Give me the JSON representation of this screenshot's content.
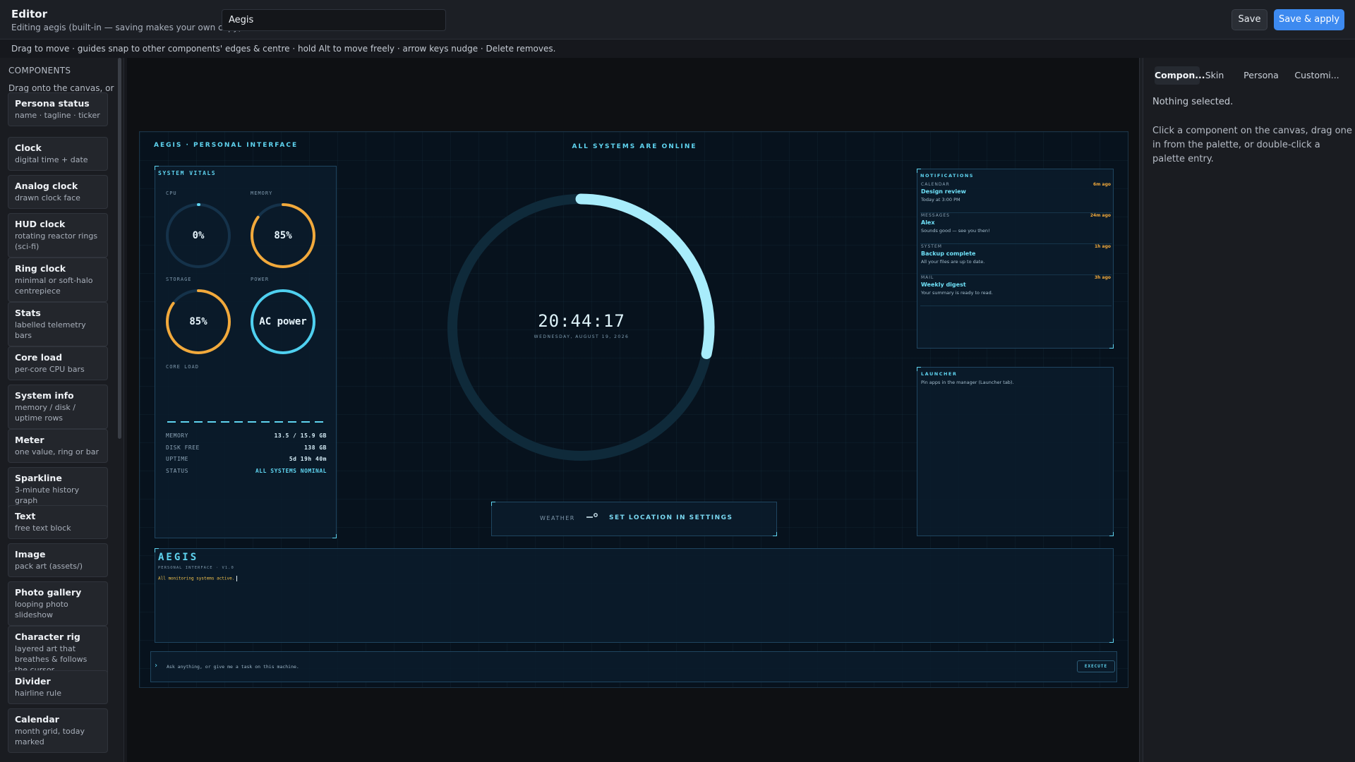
{
  "header": {
    "title": "Editor",
    "subtitle": "Editing aegis (built-in — saving makes your own copy)",
    "name_value": "Aegis",
    "save_label": "Save",
    "save_apply_label": "Save & apply"
  },
  "hint": "Drag to move · guides snap to other components' edges & centre · hold Alt to move freely · arrow keys nudge · Delete removes.",
  "palette": {
    "heading": "COMPONENTS",
    "help": "Drag onto the canvas, or double-click to add.",
    "items": [
      {
        "title": "Persona status",
        "desc": "name · tagline · ticker"
      },
      {
        "title": "Clock",
        "desc": "digital time + date"
      },
      {
        "title": "Analog clock",
        "desc": "drawn clock face"
      },
      {
        "title": "HUD clock",
        "desc": "rotating reactor rings (sci-fi)"
      },
      {
        "title": "Ring clock",
        "desc": "minimal or soft-halo centrepiece"
      },
      {
        "title": "Stats",
        "desc": "labelled telemetry bars"
      },
      {
        "title": "Core load",
        "desc": "per-core CPU bars"
      },
      {
        "title": "System info",
        "desc": "memory / disk / uptime rows"
      },
      {
        "title": "Meter",
        "desc": "one value, ring or bar"
      },
      {
        "title": "Sparkline",
        "desc": "3-minute history graph"
      },
      {
        "title": "Text",
        "desc": "free text block"
      },
      {
        "title": "Image",
        "desc": "pack art (assets/)"
      },
      {
        "title": "Photo gallery",
        "desc": "looping photo slideshow"
      },
      {
        "title": "Character rig",
        "desc": "layered art that breathes & follows the cursor"
      },
      {
        "title": "Divider",
        "desc": "hairline rule"
      },
      {
        "title": "Calendar",
        "desc": "month grid, today marked"
      }
    ]
  },
  "hud": {
    "brand": "AEGIS · PERSONAL INTERFACE",
    "status": "ALL SYSTEMS ARE ONLINE",
    "vitals": {
      "title": "SYSTEM VITALS",
      "cpu_label": "CPU",
      "cpu_value": "0%",
      "cpu_fraction": 0.0,
      "memory_label": "MEMORY",
      "memory_value": "85%",
      "memory_fraction": 0.85,
      "storage_label": "STORAGE",
      "storage_value": "85%",
      "storage_fraction": 0.85,
      "power_label": "POWER",
      "power_value": "AC power",
      "power_fraction": 1.0,
      "core_label": "CORE LOAD",
      "core_count": 12,
      "rows": [
        {
          "k": "MEMORY",
          "v": "13.5 / 15.9 GB"
        },
        {
          "k": "DISK FREE",
          "v": "138 GB"
        },
        {
          "k": "UPTIME",
          "v": "5d 19h 40m"
        },
        {
          "k": "STATUS",
          "v": "ALL SYSTEMS NOMINAL"
        }
      ]
    },
    "clock": {
      "time": "20:44:17",
      "date": "WEDNESDAY, AUGUST 19, 2026",
      "seconds_fraction": 0.283
    },
    "weather": {
      "label": "WEATHER",
      "message": "SET LOCATION IN SETTINGS"
    },
    "notifications": {
      "title": "NOTIFICATIONS",
      "items": [
        {
          "cat": "CALENDAR",
          "age": "6m ago",
          "title": "Design review",
          "msg": "Today at 3:00 PM"
        },
        {
          "cat": "MESSAGES",
          "age": "24m ago",
          "title": "Alex",
          "msg": "Sounds good — see you then!"
        },
        {
          "cat": "SYSTEM",
          "age": "1h ago",
          "title": "Backup complete",
          "msg": "All your files are up to date."
        },
        {
          "cat": "MAIL",
          "age": "3h ago",
          "title": "Weekly digest",
          "msg": "Your summary is ready to read."
        }
      ]
    },
    "launcher": {
      "title": "LAUNCHER",
      "message": "Pin apps in the manager (Launcher tab)."
    },
    "persona": {
      "name": "AEGIS",
      "tagline": "PERSONAL INTERFACE · V1.0",
      "ticker": "All monitoring systems active."
    },
    "prompt": {
      "chevron": "›",
      "placeholder": "Ask anything, or give me a task on this machine.",
      "execute": "EXECUTE"
    }
  },
  "inspector": {
    "tabs": [
      "Compon...",
      "Skin",
      "Persona",
      "Customi..."
    ],
    "active_tab": 0,
    "nothing": "Nothing selected.",
    "help": "Click a component on the canvas, drag one in from the palette, or double-click a palette entry."
  },
  "colors": {
    "accent": "#5fd4f0",
    "warn": "#f2a93b",
    "button": "#3d8af0"
  }
}
